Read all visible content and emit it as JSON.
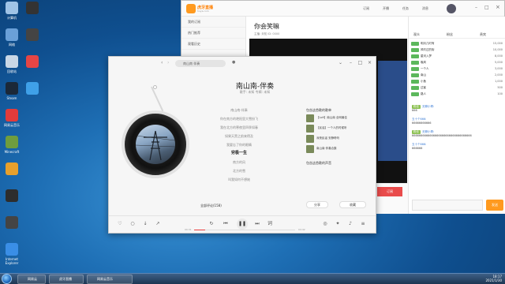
{
  "desktop": {
    "icons": [
      {
        "label": "计算机",
        "color": "#9fc3e6"
      },
      {
        "label": "网络",
        "color": "#6aa0d8"
      },
      {
        "label": "回收站",
        "color": "#c9d7e6"
      },
      {
        "label": "Steam",
        "color": "#1b2838"
      },
      {
        "label": "网易云音乐",
        "color": "#e23b3b"
      },
      {
        "label": "Minecraft",
        "color": "#6f9d3e"
      },
      {
        "label": "",
        "color": "#e7a02c"
      },
      {
        "label": "",
        "color": "#2d2d2d"
      },
      {
        "label": "",
        "color": "#444"
      },
      {
        "label": "Internet Explorer",
        "color": "#3a8ee6"
      }
    ],
    "icons_col2": [
      {
        "label": "",
        "color": "#333"
      },
      {
        "label": "",
        "color": "#444"
      },
      {
        "label": "",
        "color": "#e64545"
      },
      {
        "label": "",
        "color": "#3fa0e8"
      }
    ]
  },
  "player": {
    "search_placeholder": "南山南 伴奏",
    "song_title": "南山南-伴奏",
    "song_subtitle": "歌手: 未知  专辑: 未知",
    "lyrics": [
      "南山南-伴奏",
      "你在南方的艳阳里大雪纷飞",
      "我在北方的寒夜里四季如春",
      "如果天黑之前来得及",
      "我要忘了你的眼睛",
      "穷极一生",
      "南方的风",
      "北方的雪",
      "叫我如何不想她"
    ],
    "active_lyric_index": 5,
    "comments_label": "全部评论(158)",
    "recommend_header": "包含这首歌的歌单",
    "recommend_items": [
      "【Lofi】南山南 全网最佳",
      "【民谣】一个人的时候听",
      "深夜民谣 安静聆听",
      "南山南 伴奏合集"
    ],
    "related_header": "包含这首歌的声音",
    "share_label": "分享",
    "user_label": "收藏",
    "time_current": "00:31",
    "time_total": "04:42",
    "progress": 0.11
  },
  "live": {
    "logo_text": "虎牙直播",
    "logo_sub": "huya.com",
    "top_links": [
      "订阅",
      "开播",
      "任务",
      "消息"
    ],
    "left_items": [
      "我的订阅",
      "热门推荐",
      "观看历史"
    ],
    "room_title": "你会笑嘛",
    "room_tag": "主播: 未知   ID: 0000",
    "chat_tabs": [
      "观众",
      "粉丝",
      "贵宾"
    ],
    "rank_rows": [
      {
        "name": "明月几时有",
        "score": "15,000"
      },
      {
        "name": "风吹过的街",
        "score": "10,000"
      },
      {
        "name": "星河入梦",
        "score": "8,000"
      },
      {
        "name": "晚风",
        "score": "5,000"
      },
      {
        "name": "一个人",
        "score": "3,000"
      },
      {
        "name": "南山",
        "score": "2,000"
      },
      {
        "name": "小鱼",
        "score": "1,000"
      },
      {
        "name": "过客",
        "score": "500"
      },
      {
        "name": "路人",
        "score": "100"
      }
    ],
    "messages": [
      {
        "badge": "粉丝",
        "nick": "无聊小哥:",
        "text": "666"
      },
      {
        "badge": "",
        "nick": "五十个666:",
        "text": "66666666666"
      },
      {
        "badge": "粉丝",
        "nick": "无聊小哥:",
        "text": "6666666666666666666666666666666666"
      },
      {
        "badge": "",
        "nick": "五十个666:",
        "text": "666666"
      }
    ],
    "send_label": "发送",
    "subscribe_label": "订阅"
  },
  "taskbar": {
    "apps": [
      "网易云",
      "虎牙直播",
      "网易云音乐"
    ],
    "time": "18:17",
    "date": "2021/1/30"
  }
}
